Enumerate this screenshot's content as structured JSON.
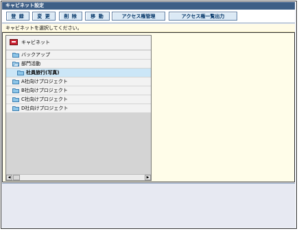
{
  "window": {
    "title": "キャビネット設定"
  },
  "toolbar": {
    "buttons": [
      {
        "label": "登 録"
      },
      {
        "label": "変 更"
      },
      {
        "label": "削 除"
      },
      {
        "label": "移 動"
      },
      {
        "label": "アクセス権管理"
      },
      {
        "label": "アクセス権一覧出力"
      }
    ]
  },
  "message": "キャビネットを選択してください。",
  "tree": {
    "root": {
      "label": "キャビネット",
      "icon": "cabinet-icon"
    },
    "items": [
      {
        "label": "バックアップ",
        "icon": "folder-icon"
      },
      {
        "label": "部門活動",
        "icon": "folder-open-icon"
      },
      {
        "label": "社員旅行(写真)",
        "icon": "folder-icon",
        "selected": true
      },
      {
        "label": "A社向けプロジェクト",
        "icon": "folder-icon"
      },
      {
        "label": "B社向けプロジェクト",
        "icon": "folder-icon"
      },
      {
        "label": "C社向けプロジェクト",
        "icon": "folder-icon"
      },
      {
        "label": "D社向けプロジェクト",
        "icon": "folder-icon"
      }
    ]
  },
  "colors": {
    "titlebar": "#3e5f86",
    "button_bg": "#dbe9f5",
    "message_bg": "#fffbe6",
    "selection": "#cbe6f7"
  }
}
